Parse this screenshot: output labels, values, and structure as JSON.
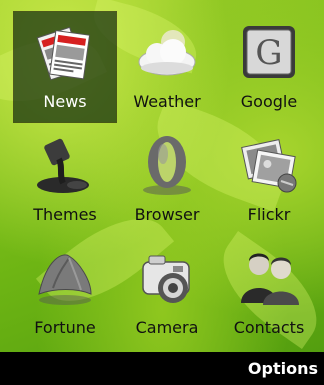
{
  "apps": [
    {
      "label": "News",
      "icon": "newspaper-icon",
      "selected": true
    },
    {
      "label": "Weather",
      "icon": "cloud-sun-icon",
      "selected": false
    },
    {
      "label": "Google",
      "icon": "google-g-icon",
      "selected": false
    },
    {
      "label": "Themes",
      "icon": "paint-can-icon",
      "selected": false
    },
    {
      "label": "Browser",
      "icon": "opera-o-icon",
      "selected": false
    },
    {
      "label": "Flickr",
      "icon": "photos-icon",
      "selected": false
    },
    {
      "label": "Fortune",
      "icon": "fortune-cookie-icon",
      "selected": false
    },
    {
      "label": "Camera",
      "icon": "camera-icon",
      "selected": false
    },
    {
      "label": "Contacts",
      "icon": "people-icon",
      "selected": false
    }
  ],
  "softkeys": {
    "right": "Options"
  },
  "colors": {
    "background": "#7cc01a",
    "selection": "#1d3a12",
    "softbar": "#000000"
  }
}
